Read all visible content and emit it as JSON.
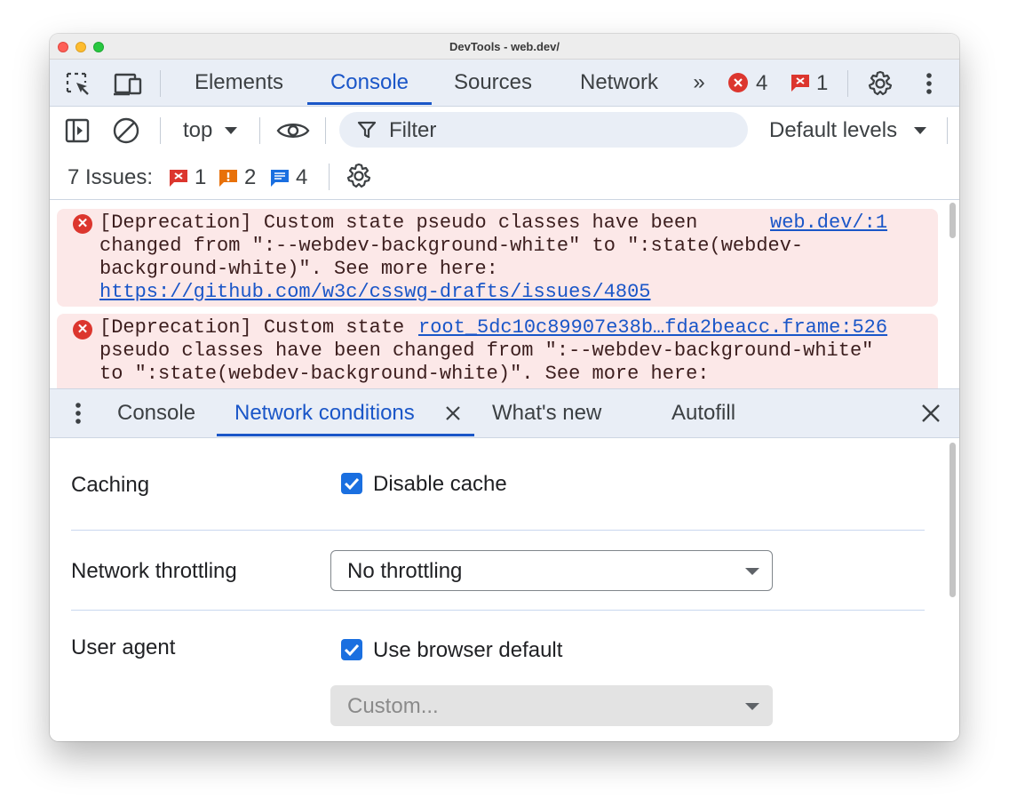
{
  "window": {
    "title": "DevTools - web.dev/"
  },
  "main_tabs": {
    "items": [
      "Elements",
      "Console",
      "Sources",
      "Network"
    ],
    "active": "Console",
    "overflow": "»",
    "error_count": "4",
    "issue_count": "1"
  },
  "toolbar": {
    "context": "top",
    "filter_placeholder": "Filter",
    "levels": "Default levels"
  },
  "issues_bar": {
    "label": "7 Issues:",
    "error_count": "1",
    "warning_count": "2",
    "info_count": "4"
  },
  "console": {
    "messages": [
      {
        "source": "web.dev/:1",
        "lines": [
          "[Deprecation] Custom state pseudo classes have been",
          "changed from \":--webdev-background-white\" to \":state(webdev-",
          "background-white)\". See more here:"
        ],
        "link": "https://github.com/w3c/csswg-drafts/issues/4805"
      },
      {
        "prefix": "[Deprecation] Custom state ",
        "source": "root_5dc10c89907e38b…fda2beacc.frame:526",
        "lines": [
          "pseudo classes have been changed from \":--webdev-background-white\"",
          "to \":state(webdev-background-white)\". See more here:"
        ]
      }
    ]
  },
  "drawer": {
    "tabs": [
      "Console",
      "Network conditions",
      "What's new",
      "Autofill"
    ],
    "active": "Network conditions"
  },
  "network_conditions": {
    "caching_label": "Caching",
    "disable_cache_label": "Disable cache",
    "disable_cache_checked": true,
    "throttling_label": "Network throttling",
    "throttling_value": "No throttling",
    "user_agent_label": "User agent",
    "use_default_label": "Use browser default",
    "use_default_checked": true,
    "custom_placeholder": "Custom..."
  },
  "colors": {
    "accent": "#1a56c8",
    "error": "#dc362e",
    "warning": "#e8710a",
    "info": "#1a6fe0"
  }
}
